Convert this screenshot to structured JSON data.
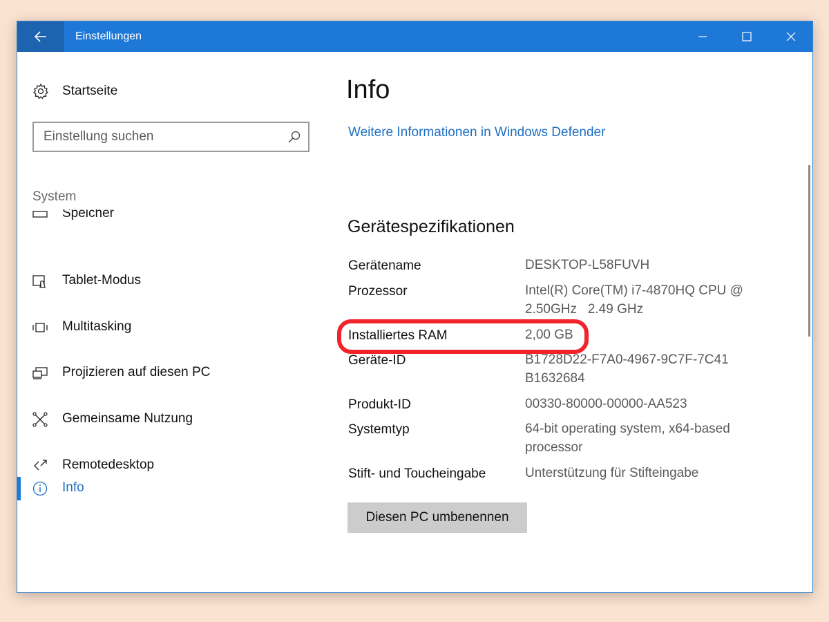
{
  "window": {
    "title": "Einstellungen"
  },
  "sidebar": {
    "home_label": "Startseite",
    "search_placeholder": "Einstellung suchen",
    "section_label": "System",
    "items": [
      {
        "label": "Speicher",
        "icon": "storage-icon"
      },
      {
        "label": "Tablet-Modus",
        "icon": "tablet-mode-icon"
      },
      {
        "label": "Multitasking",
        "icon": "multitasking-icon"
      },
      {
        "label": "Projizieren auf diesen PC",
        "icon": "project-icon"
      },
      {
        "label": "Gemeinsame Nutzung",
        "icon": "shared-experiences-icon"
      },
      {
        "label": "Remotedesktop",
        "icon": "remote-desktop-icon"
      },
      {
        "label": "Info",
        "icon": "info-icon",
        "active": true
      }
    ]
  },
  "main": {
    "title": "Info",
    "defender_link": "Weitere Informationen in Windows Defender",
    "specs_heading": "Gerätespezifikationen",
    "specs": [
      {
        "key": "Gerätename",
        "value": "DESKTOP-L58FUVH"
      },
      {
        "key": "Prozessor",
        "value": "Intel(R) Core(TM) i7-4870HQ CPU @ 2.50GHz   2.49 GHz"
      },
      {
        "key": "Installiertes RAM",
        "value": "2,00 GB"
      },
      {
        "key": "Geräte-ID",
        "value": "B1728D22-F7A0-4967-9C7F-7C41B1632684"
      },
      {
        "key": "Produkt-ID",
        "value": "00330-80000-00000-AA523"
      },
      {
        "key": "Systemtyp",
        "value": "64-bit operating system, x64-based processor"
      },
      {
        "key": "Stift- und Toucheingabe",
        "value": "Unterstützung für Stifteingabe"
      }
    ],
    "rename_button": "Diesen PC umbenennen"
  },
  "colors": {
    "accent": "#1e78d7",
    "highlight": "#f0242a"
  }
}
